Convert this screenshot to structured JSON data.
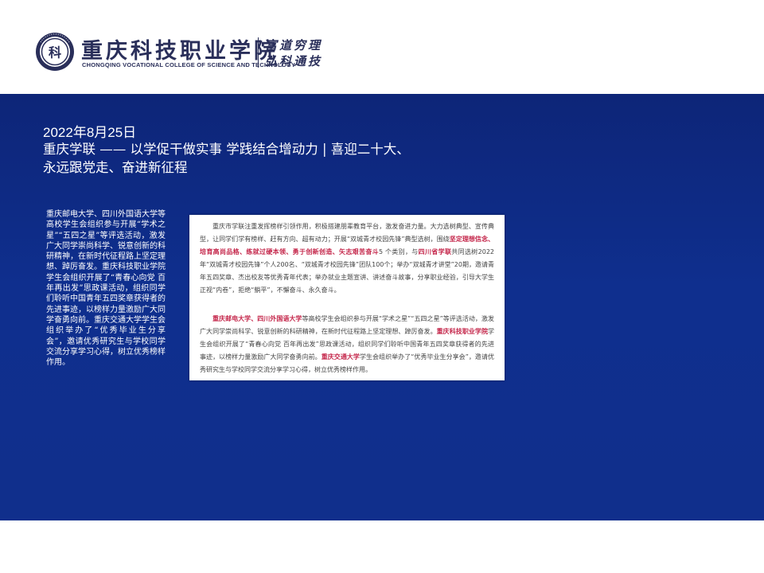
{
  "header": {
    "school_name_cn": "重庆科技职业学院",
    "school_name_en": "CHONGQING VOCATIONAL COLLEGE OF SCIENCE AND TECHNOLOGY",
    "motto_line1": "富道穷理",
    "motto_line2": "弘科通技",
    "logo_glyph": "科",
    "logo_icon": "college-seal-icon",
    "brand_color": "#2a2f5a"
  },
  "main": {
    "background_color": "#0f2b86",
    "date": "2022年8月25日",
    "title": "重庆学联 —— 以学促干做实事 学践结合增动力 | 喜迎二十大、永远跟党走、奋进新征程",
    "body": "重庆邮电大学、四川外国语大学等高校学生会组织参与开展“学术之星”“五四之星”等评选活动，激发广大同学崇尚科学、锐意创新的科研精神，在新时代征程路上坚定理想、踔厉奋发。重庆科技职业学院学生会组织开展了“青春心向党 百年再出发”思政课活动，组织同学们聆听中国青年五四奖章获得者的先进事迹，以榜样力量激励广大同学奋勇向前。重庆交通大学学生会组织举办了“优秀毕业生分享会”，邀请优秀研究生与学校同学交流分享学习心得，树立优秀榜样作用。"
  },
  "article": {
    "highlight_color": "#c4264a",
    "p1_a": "重庆市学联注重发挥榜样引领作用，积极搭建朋辈教育平台，激发奋进力量。大力选树典型、宣传典型，让同学们学有榜样、赶有方向、超有动力；开展“双城青才校园先锋”典型选树，围绕",
    "p1_h1": "坚定理想信念、培育高尚品格、练就过硬本领、勇于创新创造、矢志艰苦奋斗",
    "p1_b": "5 个类别，与",
    "p1_h2": "四川省学联",
    "p1_c": "共同选树2022年“双城青才校园先锋”个人200名、“双城青才校园先锋”团队100个；举办“双城青才讲堂”20期，邀请青年五四奖章、杰出校友等优秀青年代表；举办就业主题宣讲、讲述奋斗故事，分享职业经验，引导大学生正视“内卷”，拒绝“躺平”，不懈奋斗、永久奋斗。",
    "p2_h1": "重庆邮电大学、四川外国语大学",
    "p2_a": "等高校学生会组织参与开展“学术之星”“五四之星”等评选活动，激发广大同学崇尚科学、锐意创新的科研精神，在新时代征程路上坚定理想、踔厉奋发。",
    "p2_h2": "重庆科技职业学院",
    "p2_b": "学生会组织开展了“青春心向党 百年再出发”思政课活动，组织同学们聆听中国青年五四奖章获得者的先进事迹，以榜样力量激励广大同学奋勇向前。",
    "p2_h3": "重庆交通大学",
    "p2_c": "学生会组织举办了“优秀毕业生分享会”，邀请优秀研究生与学校同学交流分享学习心得，树立优秀榜样作用。"
  }
}
